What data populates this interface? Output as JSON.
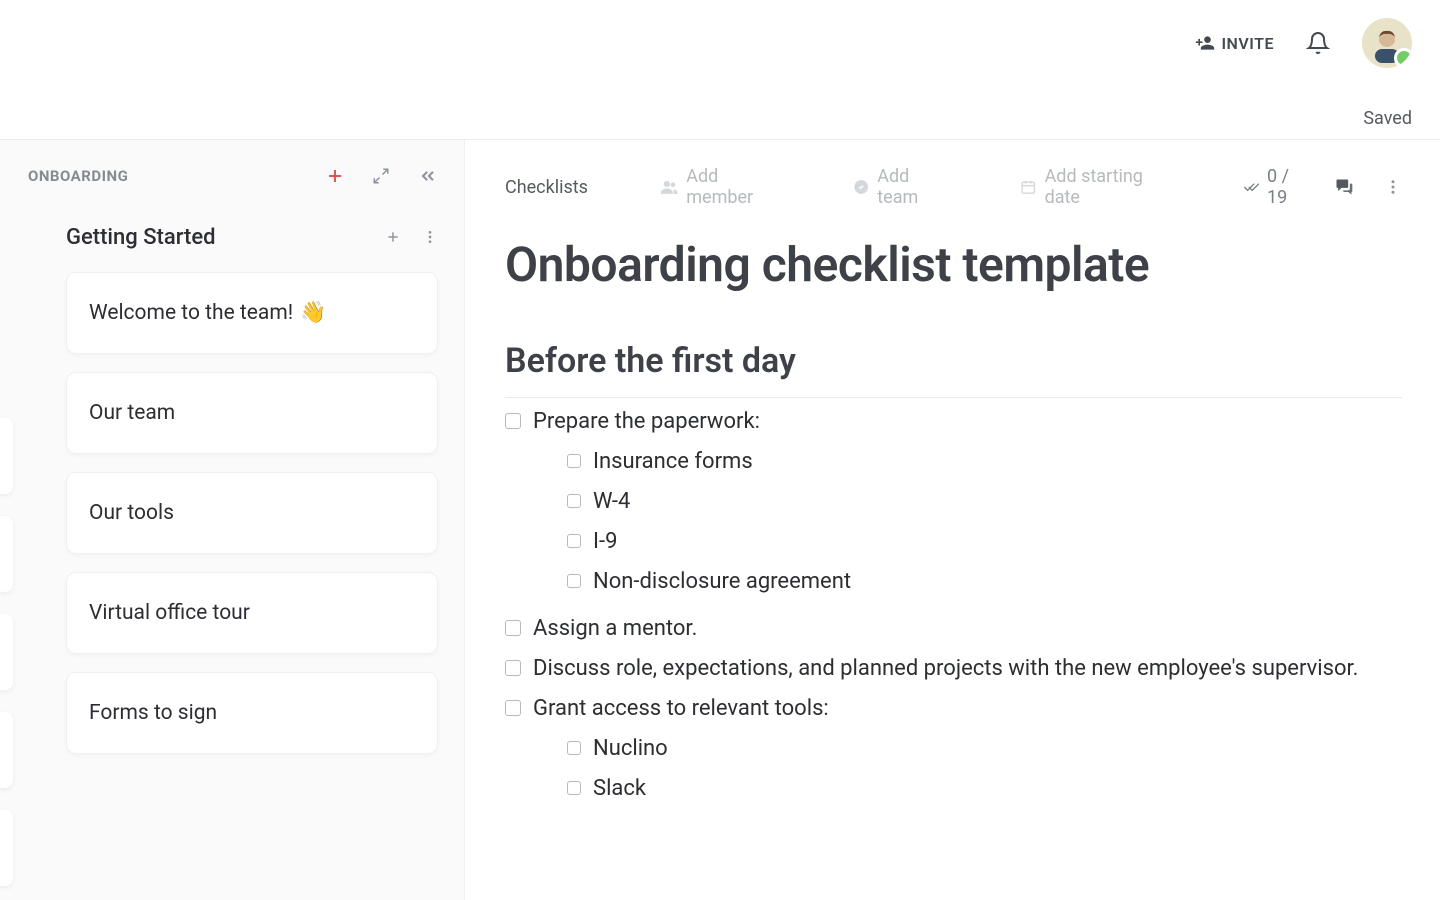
{
  "topbar": {
    "invite_label": "INVITE",
    "saved_label": "Saved"
  },
  "sidebar": {
    "workspace": "ONBOARDING",
    "collection": "Getting Started",
    "cards": [
      {
        "title": "Welcome to the team!",
        "emoji": "👋"
      },
      {
        "title": "Our team",
        "emoji": ""
      },
      {
        "title": "Our tools",
        "emoji": ""
      },
      {
        "title": "Virtual office tour",
        "emoji": ""
      },
      {
        "title": "Forms to sign",
        "emoji": ""
      }
    ]
  },
  "doc": {
    "breadcrumb": "Checklists",
    "add_member": "Add member",
    "add_team": "Add team",
    "add_date": "Add starting date",
    "counter": "0 / 19",
    "title": "Onboarding checklist template",
    "section1": "Before the first day",
    "items": {
      "i0": "Prepare the paperwork:",
      "i0a": "Insurance forms",
      "i0b": "W-4",
      "i0c": "I-9",
      "i0d": "Non-disclosure agreement",
      "i1": "Assign a mentor.",
      "i2": "Discuss role, expectations, and planned projects with the new employee's supervisor.",
      "i3": "Grant access to relevant tools:",
      "i3a": "Nuclino",
      "i3b": "Slack"
    }
  }
}
